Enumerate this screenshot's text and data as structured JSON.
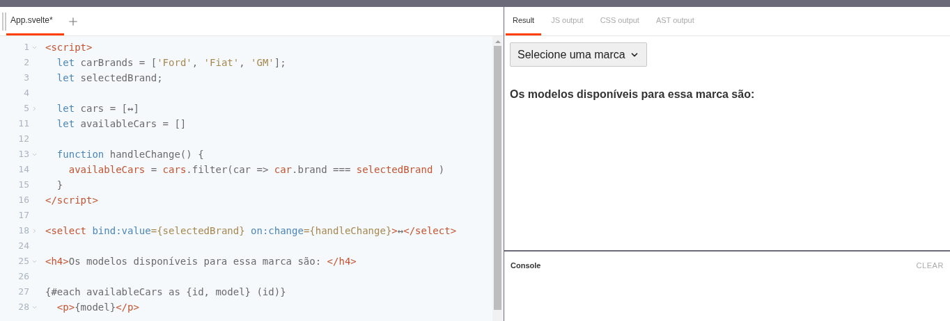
{
  "editor": {
    "tabs": [
      {
        "label": "App.svelte*",
        "selected": true
      }
    ],
    "lines": [
      {
        "number": "1",
        "folded": false,
        "tokens": [
          {
            "kind": "tag",
            "text": "<script>"
          }
        ]
      },
      {
        "number": "2",
        "tokens": [
          {
            "kind": "keyword",
            "text": "  let"
          },
          {
            "kind": "plain",
            "text": " carBrands = ["
          },
          {
            "kind": "string",
            "text": "'Ford'"
          },
          {
            "kind": "plain",
            "text": ", "
          },
          {
            "kind": "string",
            "text": "'Fiat'"
          },
          {
            "kind": "plain",
            "text": ", "
          },
          {
            "kind": "string",
            "text": "'GM'"
          },
          {
            "kind": "plain",
            "text": "];"
          }
        ]
      },
      {
        "number": "3",
        "tokens": [
          {
            "kind": "keyword",
            "text": "  let"
          },
          {
            "kind": "plain",
            "text": " selectedBrand;"
          }
        ]
      },
      {
        "number": "4"
      },
      {
        "number": "5",
        "folded": true,
        "tokens": [
          {
            "kind": "keyword",
            "text": "  let"
          },
          {
            "kind": "plain",
            "text": " cars = [↔]"
          }
        ]
      },
      {
        "number": "11",
        "tokens": [
          {
            "kind": "keyword",
            "text": "  let"
          },
          {
            "kind": "plain",
            "text": " availableCars = []"
          }
        ]
      },
      {
        "number": "12"
      },
      {
        "number": "13",
        "folded": false,
        "tokens": [
          {
            "kind": "keyword",
            "text": "  function"
          },
          {
            "kind": "plain",
            "text": " handleChange() {"
          }
        ]
      },
      {
        "number": "14",
        "tokens": [
          {
            "kind": "var",
            "text": "    availableCars"
          },
          {
            "kind": "plain",
            "text": " = "
          },
          {
            "kind": "var",
            "text": "cars"
          },
          {
            "kind": "plain",
            "text": ".filter(car => "
          },
          {
            "kind": "var",
            "text": "car"
          },
          {
            "kind": "plain",
            "text": ".brand === "
          },
          {
            "kind": "var",
            "text": "selectedBrand"
          },
          {
            "kind": "plain",
            "text": " )"
          }
        ]
      },
      {
        "number": "15",
        "tokens": [
          {
            "kind": "plain",
            "text": "  }"
          }
        ]
      },
      {
        "number": "16",
        "tokens": [
          {
            "kind": "tag",
            "text": "</script>"
          }
        ]
      },
      {
        "number": "17"
      },
      {
        "number": "18",
        "folded": true,
        "tokens": [
          {
            "kind": "tag",
            "text": "<select"
          },
          {
            "kind": "keyword",
            "text": " bind:value"
          },
          {
            "kind": "string",
            "text": "={selectedBrand}"
          },
          {
            "kind": "keyword",
            "text": " on:change"
          },
          {
            "kind": "string",
            "text": "={handleChange}"
          },
          {
            "kind": "tag",
            "text": ">"
          },
          {
            "kind": "plain",
            "text": "↔"
          },
          {
            "kind": "tag",
            "text": "</select>"
          }
        ]
      },
      {
        "number": "24"
      },
      {
        "number": "25",
        "folded": false,
        "tokens": [
          {
            "kind": "tag",
            "text": "<h4>"
          },
          {
            "kind": "plain",
            "text": "Os modelos disponíveis para essa marca são: "
          },
          {
            "kind": "tag",
            "text": "</h4>"
          }
        ]
      },
      {
        "number": "26"
      },
      {
        "number": "27",
        "tokens": [
          {
            "kind": "plain",
            "text": "{#each availableCars as {id, model} (id)}"
          }
        ]
      },
      {
        "number": "28",
        "folded": false,
        "tokens": [
          {
            "kind": "tag",
            "text": "  <p>"
          },
          {
            "kind": "plain",
            "text": "{model}"
          },
          {
            "kind": "tag",
            "text": "</p>"
          }
        ]
      }
    ]
  },
  "output": {
    "tabs": [
      {
        "label": "Result",
        "selected": true
      },
      {
        "label": "JS output",
        "selected": false
      },
      {
        "label": "CSS output",
        "selected": false
      },
      {
        "label": "AST output",
        "selected": false
      }
    ],
    "select": {
      "value": "Selecione uma marca"
    },
    "heading": "Os modelos disponíveis para essa marca são:"
  },
  "console": {
    "title": "Console",
    "clear_button": "CLEAR"
  }
}
